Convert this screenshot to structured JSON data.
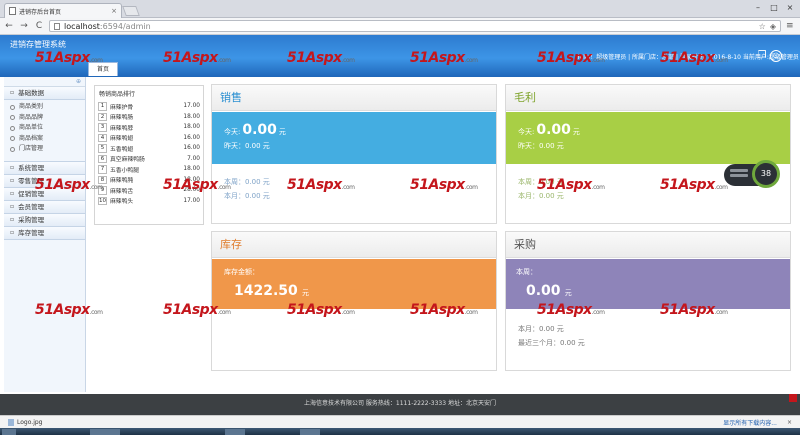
{
  "browser": {
    "tab_title": "进销存后台首页",
    "tab_close": "×",
    "url_host": "localhost",
    "url_rest": ":6594/admin",
    "nav_back": "←",
    "nav_forward": "→",
    "nav_reload": "C",
    "win_min": "–",
    "win_max": "□",
    "win_close": "×"
  },
  "app": {
    "title": "进销存管理系统",
    "user_info": "Hello！超级管理员 | 所属门店：总部 | 登录时间：2016-8-10  当前用户:超级管理员",
    "page_tab": "首页"
  },
  "watermark": {
    "text": "51Aspx",
    "suffix": ".com"
  },
  "sidebar": {
    "collapse_icon": "«",
    "groups": [
      {
        "label": "基础数据",
        "expanded": true,
        "items": [
          "商品类别",
          "商品品牌",
          "商品单位",
          "商品档案",
          "门店管理"
        ]
      },
      {
        "label": "系统管理"
      },
      {
        "label": "零售管理"
      },
      {
        "label": "促销管理"
      },
      {
        "label": "会员管理"
      },
      {
        "label": "采购管理"
      },
      {
        "label": "库存管理"
      }
    ],
    "toggle_glyph": "⊕"
  },
  "ranking": {
    "title": "畅销商品排行",
    "rows": [
      {
        "rank": "1",
        "name": "麻辣护骨",
        "value": "17.00"
      },
      {
        "rank": "2",
        "name": "麻辣鸭肠",
        "value": "18.00"
      },
      {
        "rank": "3",
        "name": "麻辣鸭脖",
        "value": "18.00"
      },
      {
        "rank": "4",
        "name": "麻辣鸭翅",
        "value": "16.00"
      },
      {
        "rank": "5",
        "name": "五香鸭翅",
        "value": "16.00"
      },
      {
        "rank": "6",
        "name": "真空麻辣鸭肠",
        "value": "7.00"
      },
      {
        "rank": "7",
        "name": "五香小鸭腿",
        "value": "18.00"
      },
      {
        "rank": "8",
        "name": "麻辣鸭肫",
        "value": "18.00"
      },
      {
        "rank": "9",
        "name": "麻辣鸭舌",
        "value": "28.00"
      },
      {
        "rank": "10",
        "name": "麻辣鸭头",
        "value": "17.00"
      }
    ]
  },
  "cards": {
    "sales": {
      "title": "销售",
      "today_label": "今天:",
      "today_value": "0.00",
      "unit": "元",
      "yesterday": "昨天：0.00 元",
      "week": "本周：0.00 元",
      "month": "本月：0.00 元",
      "color": "#44ade1"
    },
    "profit": {
      "title": "毛利",
      "today_label": "今天:",
      "today_value": "0.00",
      "unit": "元",
      "yesterday": "昨天：0.00 元",
      "week": "本周：0.00 元",
      "month": "本月：0.00 元",
      "color": "#a8cf45",
      "gauge_value": "38"
    },
    "stock": {
      "title": "库存",
      "amount_label": "库存金额：",
      "amount_value": "1422.50",
      "unit": "元",
      "color": "#f0974a"
    },
    "purchase": {
      "title": "采购",
      "week_label": "本周：",
      "week_value": "0.00",
      "unit": "元",
      "month": "本月：0.00 元",
      "quarter": "最近三个月：0.00 元",
      "color": "#8e84b9"
    }
  },
  "footer": {
    "text": "上海信意技术有限公司   服务热线：1111-2222-3333  地址：北京天安门"
  },
  "downloads": {
    "file": "Logo.jpg",
    "show_all": "显示所有下载内容...",
    "close": "×"
  }
}
